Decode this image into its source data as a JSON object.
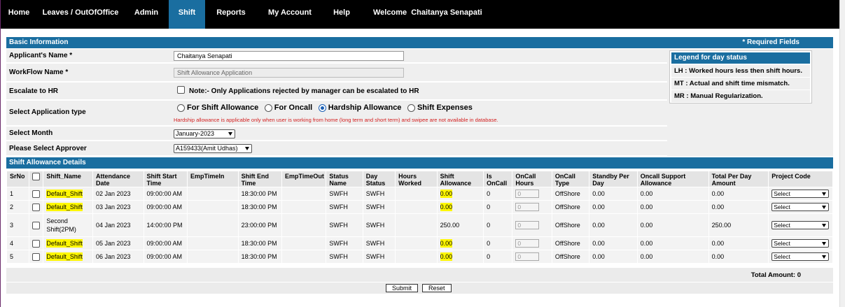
{
  "nav": {
    "items": [
      {
        "label": "Home"
      },
      {
        "label": "Leaves / OutOfOffice"
      },
      {
        "label": "Admin"
      },
      {
        "label": "Shift"
      },
      {
        "label": "Reports"
      },
      {
        "label": "My Account"
      },
      {
        "label": "Help"
      }
    ],
    "active": "Shift",
    "welcome": "Welcome  Chaitanya Senapati"
  },
  "basic": {
    "title": "Basic Information",
    "required": "* Required Fields",
    "applicant_label": "Applicant's Name *",
    "applicant_value": "Chaitanya Senapati",
    "workflow_label": "WorkFlow Name *",
    "workflow_value": "Shift Allowance Application",
    "escalate_label": "Escalate to HR",
    "escalate_note": "Note:- Only Applications rejected by manager can be escalated to HR",
    "app_type_label": "Select Application type",
    "app_types": [
      "For Shift Allowance",
      "For Oncall",
      "Hardship Allowance",
      "Shift Expenses"
    ],
    "app_type_selected": "Hardship Allowance",
    "hardship_note": "Hardship allowance is applicable only when user is working from home (long term and short term) and swipee are not available in database.",
    "month_label": "Select Month",
    "month_value": "January-2023",
    "approver_label": "Please Select Approver",
    "approver_value": "A159433(Amit Udhas)"
  },
  "legend": {
    "title": "Legend for day status",
    "items": [
      "LH : Worked hours less then shift hours.",
      "MT : Actual and shift time mismatch.",
      "MR : Manual Regularization."
    ]
  },
  "details": {
    "title": "Shift Allowance Details",
    "columns": [
      "SrNo",
      "",
      "Shift_Name",
      "Attendance Date",
      "Shift Start Time",
      "EmpTimeIn",
      "Shift End Time",
      "EmpTimeOut",
      "Status Name",
      "Day Status",
      "Hours Worked",
      "Shift Allowance",
      "Is OnCall",
      "OnCall Hours",
      "OnCall Type",
      "Standby Per Day",
      "Oncall Support Allowance",
      "Total Per Day Amount",
      "Project Code"
    ],
    "rows": [
      {
        "sr": "1",
        "shift": "Default_Shift",
        "date": "02 Jan 2023",
        "start": "09:00:00 AM",
        "tin": "",
        "end": "18:30:00 PM",
        "tout": "",
        "status": "SWFH",
        "day": "SWFH",
        "hours": "",
        "allow": "0.00",
        "oncall": "0",
        "och": "0",
        "oct": "OffShore",
        "standby": "0.00",
        "support": "0.00",
        "total": "0.00",
        "project": "Select",
        "hl": true
      },
      {
        "sr": "2",
        "shift": "Default_Shift",
        "date": "03 Jan 2023",
        "start": "09:00:00 AM",
        "tin": "",
        "end": "18:30:00 PM",
        "tout": "",
        "status": "SWFH",
        "day": "SWFH",
        "hours": "",
        "allow": "0.00",
        "oncall": "0",
        "och": "0",
        "oct": "OffShore",
        "standby": "0.00",
        "support": "0.00",
        "total": "0.00",
        "project": "Select",
        "hl": true
      },
      {
        "sr": "3",
        "shift": "Second Shift(2PM)",
        "date": "04 Jan 2023",
        "start": "14:00:00 PM",
        "tin": "",
        "end": "23:00:00 PM",
        "tout": "",
        "status": "SWFH",
        "day": "SWFH",
        "hours": "",
        "allow": "250.00",
        "oncall": "0",
        "och": "0",
        "oct": "OffShore",
        "standby": "0.00",
        "support": "0.00",
        "total": "250.00",
        "project": "Select",
        "hl": false
      },
      {
        "sr": "4",
        "shift": "Default_Shift",
        "date": "05 Jan 2023",
        "start": "09:00:00 AM",
        "tin": "",
        "end": "18:30:00 PM",
        "tout": "",
        "status": "SWFH",
        "day": "SWFH",
        "hours": "",
        "allow": "0.00",
        "oncall": "0",
        "och": "0",
        "oct": "OffShore",
        "standby": "0.00",
        "support": "0.00",
        "total": "0.00",
        "project": "Select",
        "hl": true
      },
      {
        "sr": "5",
        "shift": "Default_Shift",
        "date": "06 Jan 2023",
        "start": "09:00:00 AM",
        "tin": "",
        "end": "18:30:00 PM",
        "tout": "",
        "status": "SWFH",
        "day": "SWFH",
        "hours": "",
        "allow": "0.00",
        "oncall": "0",
        "och": "0",
        "oct": "OffShore",
        "standby": "0.00",
        "support": "0.00",
        "total": "0.00",
        "project": "Select",
        "hl": true
      }
    ],
    "total_amount": "Total Amount: 0",
    "submit_label": "Submit",
    "reset_label": "Reset"
  },
  "colors": {
    "header_blue": "#1a6ea0",
    "nav_bg": "#000000",
    "highlight": "#fff700",
    "note_red": "#d42020"
  },
  "icons": [
    "dropdown-arrow-icon",
    "checkbox-icon",
    "radio-icon"
  ]
}
